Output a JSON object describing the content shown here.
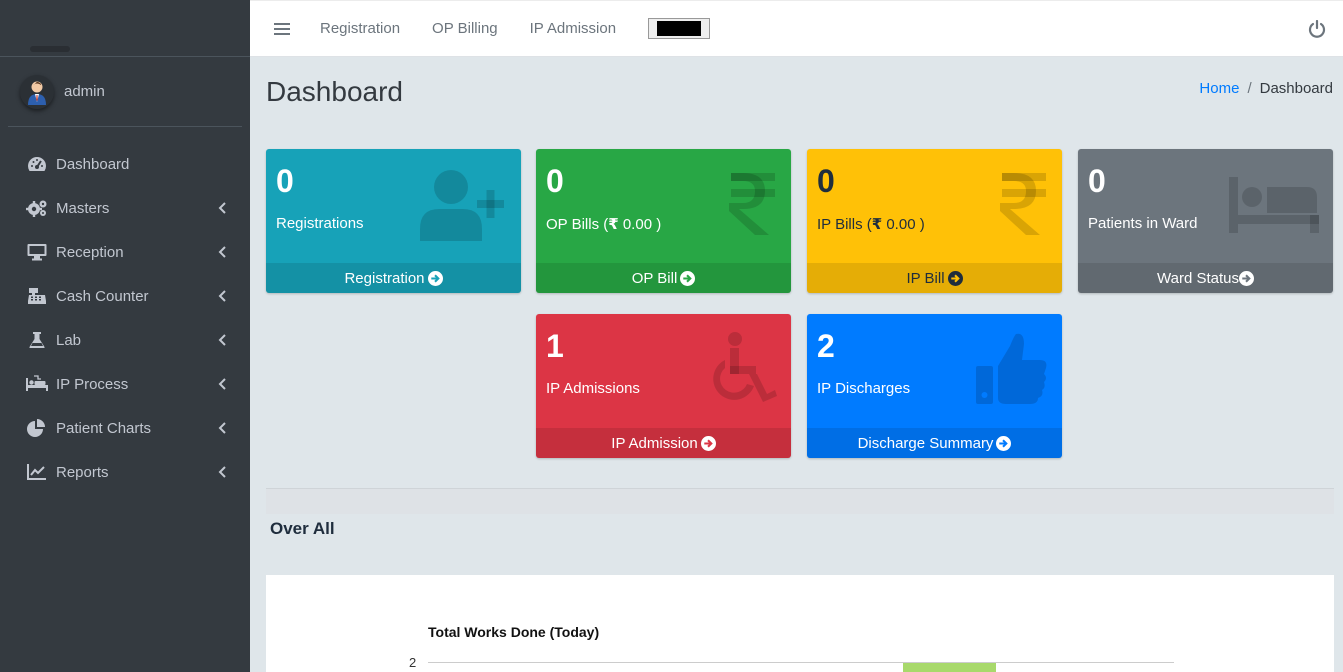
{
  "sidebar": {
    "user": {
      "name": "admin"
    },
    "items": [
      {
        "label": "Dashboard",
        "icon": "tachometer-icon",
        "has_children": false
      },
      {
        "label": "Masters",
        "icon": "cogs-icon",
        "has_children": true
      },
      {
        "label": "Reception",
        "icon": "desktop-icon",
        "has_children": true
      },
      {
        "label": "Cash Counter",
        "icon": "cash-register-icon",
        "has_children": true
      },
      {
        "label": "Lab",
        "icon": "flask-icon",
        "has_children": true
      },
      {
        "label": "IP Process",
        "icon": "procedures-icon",
        "has_children": true
      },
      {
        "label": "Patient Charts",
        "icon": "chart-pie-icon",
        "has_children": true
      },
      {
        "label": "Reports",
        "icon": "chart-line-icon",
        "has_children": true
      }
    ]
  },
  "topbar": {
    "links": [
      "Registration",
      "OP Billing",
      "IP Admission"
    ]
  },
  "page": {
    "title": "Dashboard",
    "breadcrumb": {
      "home": "Home",
      "current": "Dashboard"
    }
  },
  "boxes": {
    "registrations": {
      "count": "0",
      "label": "Registrations",
      "footer": "Registration",
      "color": "#17a2b8",
      "icon": "user-plus-icon"
    },
    "op_bills": {
      "count": "0",
      "label": "OP Bills (",
      "amount": "0.00",
      "label_end": " )",
      "footer": "OP Bill",
      "color": "#28a745",
      "icon": "rupee-icon"
    },
    "ip_bills": {
      "count": "0",
      "label": "IP Bills (",
      "amount": "0.00",
      "label_end": " )",
      "footer": "IP Bill",
      "color": "#ffc107",
      "icon": "rupee-icon"
    },
    "ward": {
      "count": "0",
      "label": "Patients in Ward",
      "footer": "Ward Status",
      "color": "#6c757d",
      "icon": "bed-icon"
    },
    "ip_admissions": {
      "count": "1",
      "label": "IP Admissions",
      "footer": "IP Admission",
      "color": "#dc3545",
      "icon": "wheelchair-icon"
    },
    "ip_discharges": {
      "count": "2",
      "label": "IP Discharges",
      "footer": "Discharge Summary",
      "color": "#007bff",
      "icon": "thumbs-up-icon"
    }
  },
  "section": {
    "title": "Over All"
  },
  "chart_data": {
    "type": "bar",
    "title": "Total Works Done (Today)",
    "y_ticks_visible": [
      "2"
    ],
    "ymax_visible": 2,
    "bar_color": "#a8d96b",
    "categories": [],
    "values": [],
    "note_visible_bar_value": 2
  }
}
